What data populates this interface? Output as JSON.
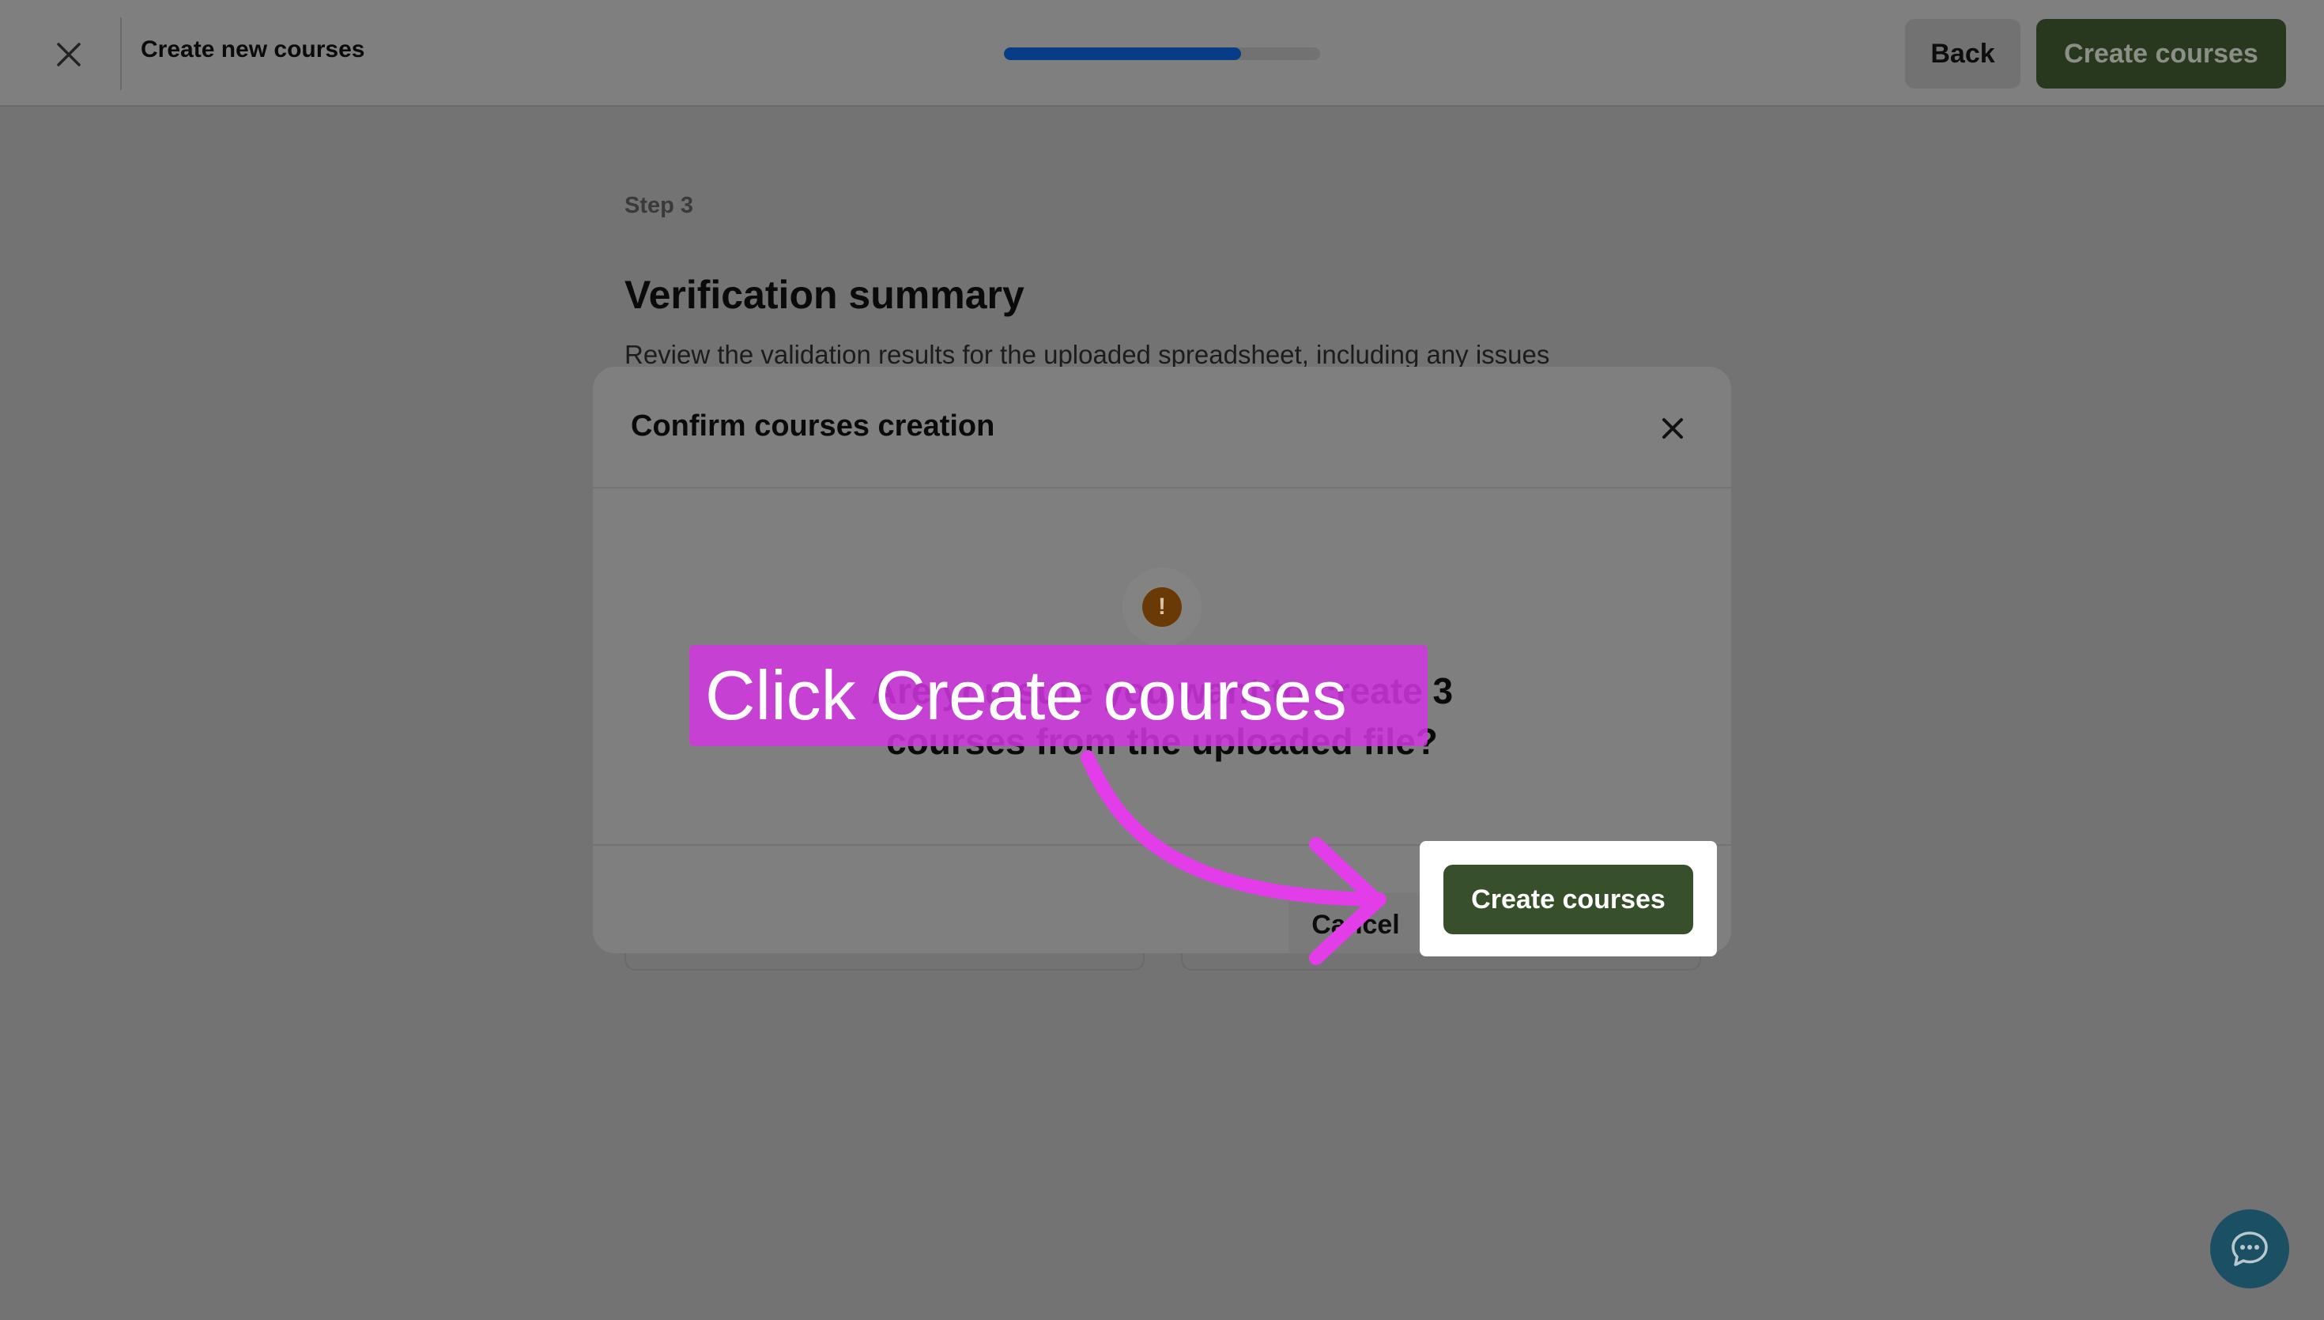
{
  "topbar": {
    "title": "Create new courses",
    "progress_fraction": 0.75,
    "back_label": "Back",
    "create_label": "Create courses"
  },
  "page": {
    "step_label": "Step 3",
    "heading": "Verification summary",
    "description": "Review the validation results for the uploaded spreadsheet, including any issues"
  },
  "modal": {
    "title": "Confirm courses creation",
    "question": "Are you sure you want to create 3 courses from the uploaded file?",
    "cancel_label": "Cancel",
    "confirm_label": "Create courses"
  },
  "overlay": {
    "instruction": "Click Create courses"
  },
  "colors": {
    "accent_green": "#384f2b",
    "progress_blue": "#063d86",
    "warning_orange": "#6a3a06",
    "callout_magenta": "#d237e1"
  },
  "icons": {
    "topbar_close": "close-icon",
    "modal_close": "close-icon",
    "warning": "exclamation-icon",
    "chat": "chat-bubble-icon"
  }
}
